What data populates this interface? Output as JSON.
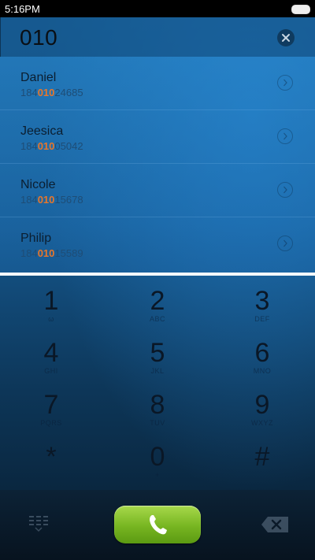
{
  "status_bar": {
    "time": "5:16PM"
  },
  "search": {
    "value": "010"
  },
  "results": [
    {
      "name": "Daniel",
      "number_prefix": "184",
      "number_match": "010",
      "number_suffix": "24685"
    },
    {
      "name": "Jeesica",
      "number_prefix": "184",
      "number_match": "010",
      "number_suffix": "05042"
    },
    {
      "name": "Nicole",
      "number_prefix": "184",
      "number_match": "010",
      "number_suffix": "15678"
    },
    {
      "name": "Philip",
      "number_prefix": "184",
      "number_match": "010",
      "number_suffix": "15589"
    }
  ],
  "keypad": {
    "keys": [
      {
        "digit": "1",
        "letters": "ω"
      },
      {
        "digit": "2",
        "letters": "ABC"
      },
      {
        "digit": "3",
        "letters": "DEF"
      },
      {
        "digit": "4",
        "letters": "GHI"
      },
      {
        "digit": "5",
        "letters": "JKL"
      },
      {
        "digit": "6",
        "letters": "MNO"
      },
      {
        "digit": "7",
        "letters": "PQRS"
      },
      {
        "digit": "8",
        "letters": "TUV"
      },
      {
        "digit": "9",
        "letters": "WXYZ"
      },
      {
        "digit": "*",
        "letters": ""
      },
      {
        "digit": "0",
        "letters": "+"
      },
      {
        "digit": "#",
        "letters": ""
      }
    ]
  },
  "colors": {
    "highlight": "#e8762a",
    "call_green": "#77b521",
    "divider": "#f4f8fb"
  },
  "icons": {
    "clear": "close-circle-icon",
    "detail": "chevron-right-circle-icon",
    "keypad_toggle": "dialpad-icon",
    "call": "phone-icon",
    "backspace": "backspace-icon"
  }
}
